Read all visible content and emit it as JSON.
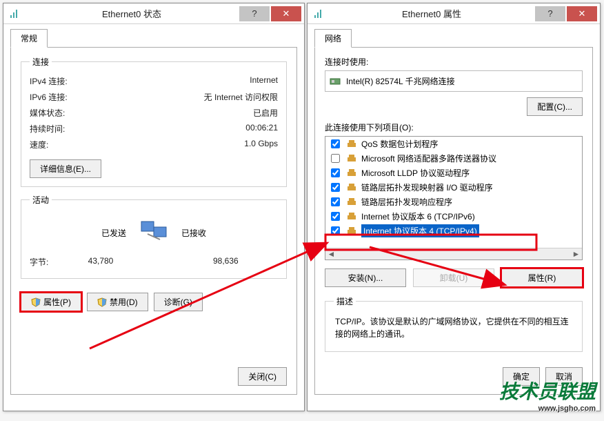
{
  "left": {
    "title": "Ethernet0 状态",
    "tab": "常规",
    "conn_legend": "连接",
    "ipv4_label": "IPv4 连接:",
    "ipv4_value": "Internet",
    "ipv6_label": "IPv6 连接:",
    "ipv6_value": "无 Internet 访问权限",
    "media_label": "媒体状态:",
    "media_value": "已启用",
    "duration_label": "持续时间:",
    "duration_value": "00:06:21",
    "speed_label": "速度:",
    "speed_value": "1.0 Gbps",
    "details_btn": "详细信息(E)...",
    "activity_legend": "活动",
    "sent_label": "已发送",
    "recv_label": "已接收",
    "bytes_label": "字节:",
    "bytes_sent": "43,780",
    "bytes_recv": "98,636",
    "props_btn": "属性(P)",
    "disable_btn": "禁用(D)",
    "diag_btn": "诊断(G)",
    "close_btn": "关闭(C)"
  },
  "right": {
    "title": "Ethernet0 属性",
    "tab": "网络",
    "connect_using": "连接时使用:",
    "adapter": "Intel(R) 82574L 千兆网络连接",
    "configure_btn": "配置(C)...",
    "uses_label": "此连接使用下列项目(O):",
    "items": [
      {
        "checked": true,
        "label": "QoS 数据包计划程序"
      },
      {
        "checked": false,
        "label": "Microsoft 网络适配器多路传送器协议"
      },
      {
        "checked": true,
        "label": "Microsoft LLDP 协议驱动程序"
      },
      {
        "checked": true,
        "label": "链路层拓扑发现映射器 I/O 驱动程序"
      },
      {
        "checked": true,
        "label": "链路层拓扑发现响应程序"
      },
      {
        "checked": true,
        "label": "Internet 协议版本 6 (TCP/IPv6)"
      },
      {
        "checked": true,
        "label": "Internet 协议版本 4 (TCP/IPv4)",
        "selected": true
      }
    ],
    "install_btn": "安装(N)...",
    "uninstall_btn": "卸载(U)",
    "props_btn": "属性(R)",
    "desc_legend": "描述",
    "desc_text": "TCP/IP。该协议是默认的广域网络协议，它提供在不同的相互连接的网络上的通讯。",
    "ok_btn": "确定",
    "cancel_btn": "取消"
  },
  "watermark": {
    "big": "技术员联盟",
    "small": "www.jsgho.com"
  }
}
